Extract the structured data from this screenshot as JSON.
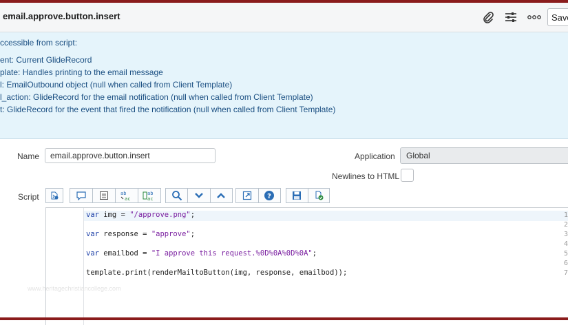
{
  "header": {
    "title": "email.approve.button.insert",
    "save_label": "Save",
    "icons": [
      "paperclip-icon",
      "sliders-icon",
      "more-icon"
    ]
  },
  "info": {
    "heading": "ccessible from script:",
    "lines": [
      "ent: Current GlideRecord",
      "plate: Handles printing to the email message",
      "l: EmailOutbound object (null when called from Client Template)",
      "l_action: GlideRecord for the email notification (null when called from Client Template)",
      "t: GlideRecord for the event that fired the notification (null when called from Client Template)"
    ]
  },
  "form": {
    "name_label": "Name",
    "name_value": "email.approve.button.insert",
    "application_label": "Application",
    "application_value": "Global",
    "newlines_label": "Newlines to HTML",
    "newlines_checked": false,
    "script_label": "Script"
  },
  "toolbar": {
    "groups": [
      [
        "format-code-icon"
      ],
      [
        "comment-icon",
        "toggle-comment-icon",
        "replace-icon",
        "replace-all-icon"
      ],
      [
        "search-icon",
        "collapse-icon",
        "expand-icon"
      ],
      [
        "fullscreen-icon",
        "help-icon"
      ],
      [
        "save-script-icon",
        "check-script-icon"
      ]
    ]
  },
  "editor": {
    "line_numbers": [
      "1",
      "2",
      "3",
      "4",
      "5",
      "6",
      "7"
    ],
    "lines": [
      [
        {
          "t": "kw",
          "v": "var"
        },
        {
          "t": "p",
          "v": " img = "
        },
        {
          "t": "str",
          "v": "\"/approve.png\""
        },
        {
          "t": "p",
          "v": ";"
        }
      ],
      [],
      [
        {
          "t": "kw",
          "v": "var"
        },
        {
          "t": "p",
          "v": " response = "
        },
        {
          "t": "str",
          "v": "\"approve\""
        },
        {
          "t": "p",
          "v": ";"
        }
      ],
      [],
      [
        {
          "t": "kw",
          "v": "var"
        },
        {
          "t": "p",
          "v": " emailbod = "
        },
        {
          "t": "str",
          "v": "\"I approve this request.%0D%0A%0D%0A\""
        },
        {
          "t": "p",
          "v": ";"
        }
      ],
      [],
      [
        {
          "t": "p",
          "v": "template.print(renderMailtoButton(img, response, emailbod));"
        }
      ]
    ],
    "watermark": "www.heritagechristiancollege.com"
  }
}
